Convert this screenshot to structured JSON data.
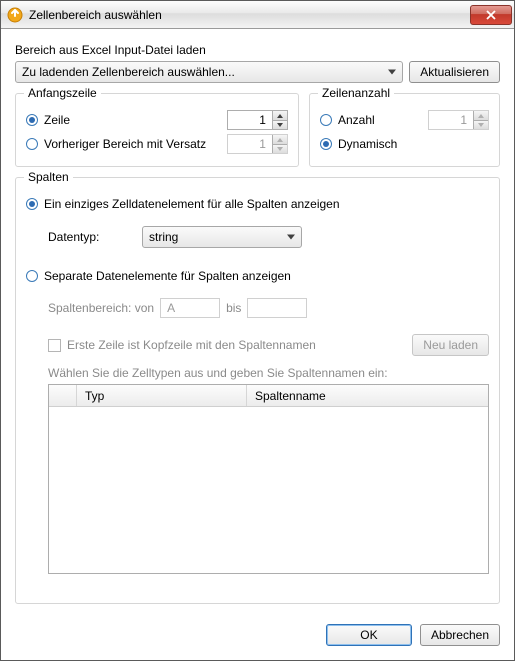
{
  "window": {
    "title": "Zellenbereich auswählen"
  },
  "load": {
    "label": "Bereich aus Excel Input-Datei laden",
    "select_placeholder": "Zu ladenden Zellenbereich auswählen...",
    "refresh": "Aktualisieren"
  },
  "start_row": {
    "legend": "Anfangszeile",
    "row_radio": "Zeile",
    "row_value": "1",
    "prev_radio": "Vorheriger Bereich mit Versatz",
    "prev_value": "1"
  },
  "row_count": {
    "legend": "Zeilenanzahl",
    "count_radio": "Anzahl",
    "count_value": "1",
    "dynamic_radio": "Dynamisch"
  },
  "columns": {
    "legend": "Spalten",
    "single_radio": "Ein einziges Zelldatenelement für alle Spalten anzeigen",
    "datatype_label": "Datentyp:",
    "datatype_value": "string",
    "separate_radio": "Separate Datenelemente für Spalten anzeigen",
    "range_from_label": "Spaltenbereich: von",
    "range_from_value": "A",
    "range_to_label": "bis",
    "range_to_value": "",
    "header_checkbox_label": "Erste Zeile ist Kopfzeile mit den Spaltennamen",
    "reload_btn": "Neu laden",
    "table_caption": "Wählen Sie die Zelltypen aus und geben Sie Spaltennamen ein:",
    "th_type": "Typ",
    "th_name": "Spaltenname"
  },
  "footer": {
    "ok": "OK",
    "cancel": "Abbrechen"
  }
}
